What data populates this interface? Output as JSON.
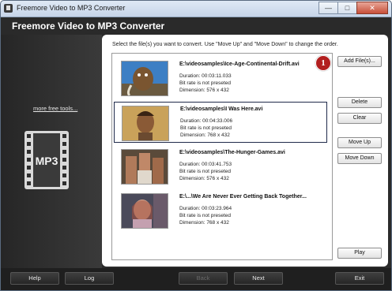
{
  "window": {
    "title": "Freemore Video to MP3 Converter",
    "controls": [
      "minimize",
      "maximize",
      "close"
    ]
  },
  "app": {
    "title": "Freemore Video to MP3 Converter"
  },
  "sidebar": {
    "more_link": "more free tools...",
    "logo_text": "MP3"
  },
  "main": {
    "instruction": "Select the file(s) you want to convert. Use \"Move Up\" and \"Move Down\" to change the order.",
    "files": [
      {
        "name": "E:\\videosamples\\Ice-Age-Continental-Drift.avi",
        "duration": "Duration: 00:03:11.033",
        "bitrate": "Bit rate is not preseted",
        "dimension": "Dimension: 576 x 432",
        "selected": false
      },
      {
        "name": "E:\\videosamples\\I Was Here.avi",
        "duration": "Duration: 00:04:33.006",
        "bitrate": "Bit rate is not preseted",
        "dimension": "Dimension: 768 x 432",
        "selected": true
      },
      {
        "name": "E:\\videosamples\\The-Hunger-Games.avi",
        "duration": "Duration: 00:03:41.753",
        "bitrate": "Bit rate is not preseted",
        "dimension": "Dimension: 576 x 432",
        "selected": false
      },
      {
        "name": "E:\\...\\We Are Never Ever Getting Back Together...",
        "duration": "Duration: 00:03:23.964",
        "bitrate": "Bit rate is not preseted",
        "dimension": "Dimension: 768 x 432",
        "selected": false
      }
    ],
    "buttons": {
      "add": "Add File(s)...",
      "delete": "Delete",
      "clear": "Clear",
      "move_up": "Move Up",
      "move_down": "Move Down",
      "play": "Play"
    },
    "marker": "1"
  },
  "footer": {
    "help": "Help",
    "log": "Log",
    "back": "Back",
    "next": "Next",
    "exit": "Exit"
  },
  "colors": {
    "accent_marker": "#b21f1f",
    "dark_bg": "#2b2b2b",
    "selection_border": "#1f2a4a"
  }
}
